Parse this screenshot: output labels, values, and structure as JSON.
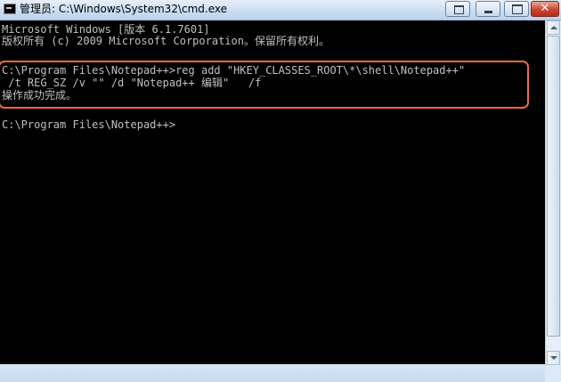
{
  "window": {
    "title": "管理员: C:\\Windows\\System32\\cmd.exe",
    "app_icon": "cmd-icon"
  },
  "console": {
    "lines": [
      "Microsoft Windows [版本 6.1.7601]",
      "版权所有 (c) 2009 Microsoft Corporation。保留所有权利。",
      "",
      "C:\\Program Files\\Notepad++>reg add \"HKEY_CLASSES_ROOT\\*\\shell\\Notepad++\"",
      " /t REG_SZ /v \"\" /d \"Notepad++ 编辑\"   /f",
      "操作成功完成。",
      "",
      "C:\\Program Files\\Notepad++>"
    ],
    "highlight_color": "#ef6c3a"
  },
  "controls": {
    "close_glyph": "✕"
  },
  "colors": {
    "console_bg": "#000000",
    "console_text": "#c0c0c0",
    "titlebar": "#c9dcf1",
    "close_button": "#c9452f"
  }
}
